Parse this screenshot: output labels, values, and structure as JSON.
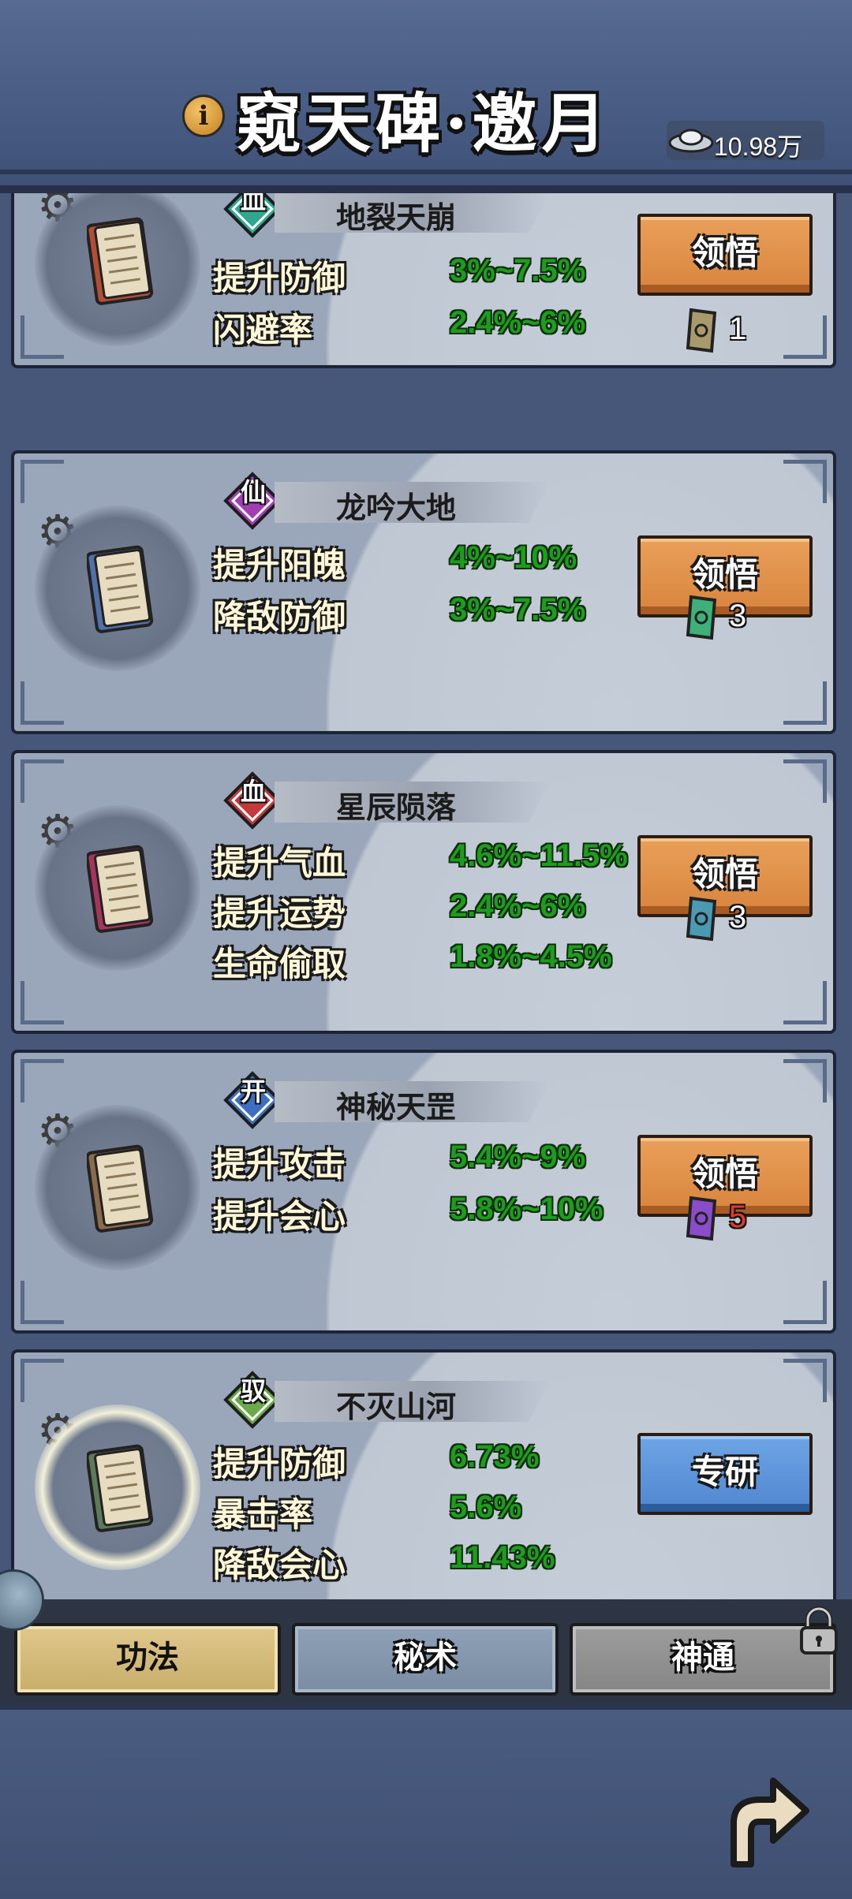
{
  "header": {
    "title": "窥天碑·邀月",
    "info_icon": "i",
    "currency": {
      "icon": "silver-ingot-icon",
      "value": "10.98万"
    }
  },
  "skills": [
    {
      "badge": "血",
      "badge_color": "#2fa890",
      "name": "地裂天崩",
      "scroll_color": "#b24d36",
      "stats": [
        {
          "label": "提升防御",
          "value": "3%~7.5%"
        },
        {
          "label": "闪避率",
          "value": "2.4%~6%"
        }
      ],
      "button": "领悟",
      "button_style": "orange",
      "talisman_color": "#a89a6a",
      "talisman_count": "1"
    },
    {
      "badge": "仙",
      "badge_color": "#a23db4",
      "name": "龙吟大地",
      "scroll_color": "#5270a8",
      "stats": [
        {
          "label": "提升阳魄",
          "value": "4%~10%"
        },
        {
          "label": "降敌防御",
          "value": "3%~7.5%"
        }
      ],
      "button": "领悟",
      "button_style": "orange",
      "talisman_color": "#3fb07a",
      "talisman_count": "3"
    },
    {
      "badge": "血",
      "badge_color": "#c23a3a",
      "name": "星辰陨落",
      "scroll_color": "#a3365a",
      "stats": [
        {
          "label": "提升气血",
          "value": "4.6%~11.5%"
        },
        {
          "label": "提升运势",
          "value": "2.4%~6%"
        },
        {
          "label": "生命偷取",
          "value": "1.8%~4.5%"
        }
      ],
      "button": "领悟",
      "button_style": "orange",
      "talisman_color": "#4a9ab4",
      "talisman_count": "3"
    },
    {
      "badge": "开",
      "badge_color": "#3d6fc0",
      "name": "神秘天罡",
      "scroll_color": "#8c6a4c",
      "stats": [
        {
          "label": "提升攻击",
          "value": "5.4%~9%"
        },
        {
          "label": "提升会心",
          "value": "5.8%~10%"
        }
      ],
      "button": "领悟",
      "button_style": "orange",
      "talisman_color": "#8a4cc8",
      "talisman_count": "5",
      "talisman_count_color": "#e43a2a"
    },
    {
      "badge": "驭",
      "badge_color": "#6aaa4a",
      "name": "不灭山河",
      "scroll_color": "#5f7a5a",
      "stats": [
        {
          "label": "提升防御",
          "value": "6.73%"
        },
        {
          "label": "暴击率",
          "value": "5.6%"
        },
        {
          "label": "降敌会心",
          "value": "11.43%"
        }
      ],
      "button": "专研",
      "button_style": "blue"
    }
  ],
  "tabs": [
    {
      "label": "功法",
      "state": "active"
    },
    {
      "label": "秘术",
      "state": "normal"
    },
    {
      "label": "神通",
      "state": "locked"
    }
  ],
  "footer": {
    "back_icon": "return-arrow-icon"
  }
}
